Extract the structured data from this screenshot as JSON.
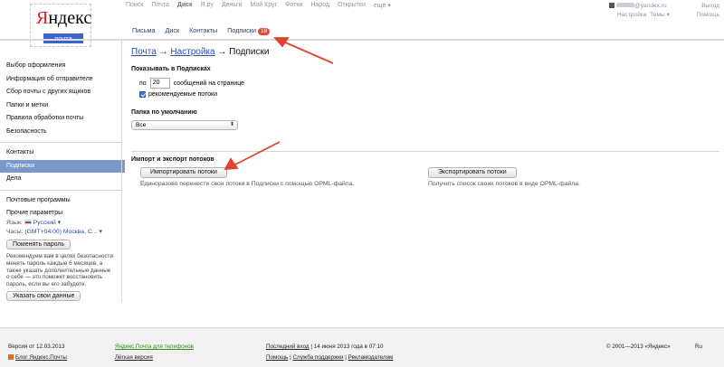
{
  "logo": {
    "text_red": "Я",
    "text_rest": "ндекс",
    "badge": "почта"
  },
  "topnav": [
    "Поиск",
    "Почта",
    "Диск",
    "Я.ру",
    "Деньги",
    "Мой Круг",
    "Фотки",
    "Народ",
    "Открытки",
    "ещё ▾"
  ],
  "user": {
    "email_suffix": "@yandex.ru",
    "logout": "Выход",
    "settings": "Настройка",
    "themes": "Темы ▾",
    "help": "Помощь"
  },
  "mailtabs": [
    {
      "label": "Письма"
    },
    {
      "label": "Диск"
    },
    {
      "label": "Контакты"
    },
    {
      "label": "Подписки",
      "badge": "18"
    }
  ],
  "breadcrumb": {
    "a": "Почта",
    "arrow1": " → ",
    "b": "Настройка",
    "arrow2": " → ",
    "current": "Подписки"
  },
  "left_menu": {
    "group1": [
      "Выбор оформления",
      "Информация об отправителе",
      "Сбор почты с других ящиков",
      "Папки и метки",
      "Правила обработки почты",
      "Безопасность"
    ],
    "group2": [
      "Контакты",
      "Подписки",
      "Дела"
    ],
    "group3": [
      "Почтовые программы",
      "Прочие параметры"
    ],
    "active": "Подписки"
  },
  "lang": {
    "lang_label": "Язык:",
    "lang_value": "Русский ▾",
    "clock_label": "Часы:",
    "clock_value": "(GMT+04:00) Москва, С... ▾",
    "change_password": "Поменять пароль",
    "note": "Рекомендуем вам в целях безопасности менять пароль каждые 6 месяцев, а также указать дополнительные данные о себе — это поможет восстановить пароль, если вы его забудете.",
    "your_data": "Указать свои данные"
  },
  "show": {
    "heading": "Показывать в Подписках",
    "per": "по",
    "count": "20",
    "suffix": "сообщений на странице",
    "recommended": "рекомендуемые потоки"
  },
  "folder": {
    "heading": "Папка по умолчанию",
    "selected": "Все"
  },
  "io": {
    "heading": "Импорт и экспорт потоков",
    "import_button": "Импортировать потоки",
    "import_desc": "Единоразово перенести свои потоки в Подписки с помощью OPML-файла.",
    "export_button": "Экспортировать потоки",
    "export_desc": "Получить список своих потоков в виде OPML-файла."
  },
  "footer": {
    "version": "Версия от 12.03.2013",
    "blog": "Блог Яндекс.Почты",
    "mobile": "Яндекс.Почта для телефонов",
    "lite": "Лёгкая версия",
    "last_login_label": "Последний вход",
    "last_login_value": " | 14 июня 2013 года в 07:10",
    "help": "Помощь",
    "support": "Служба поддержки",
    "ads": "Рекламодателям",
    "sep": " | ",
    "copyright": "© 2001—2013 «Яндекс»",
    "lang": "Ru"
  },
  "colors": {
    "active_menu": "#7a98cc",
    "arrow": "#e0442e",
    "badge": "#e24c2a"
  }
}
